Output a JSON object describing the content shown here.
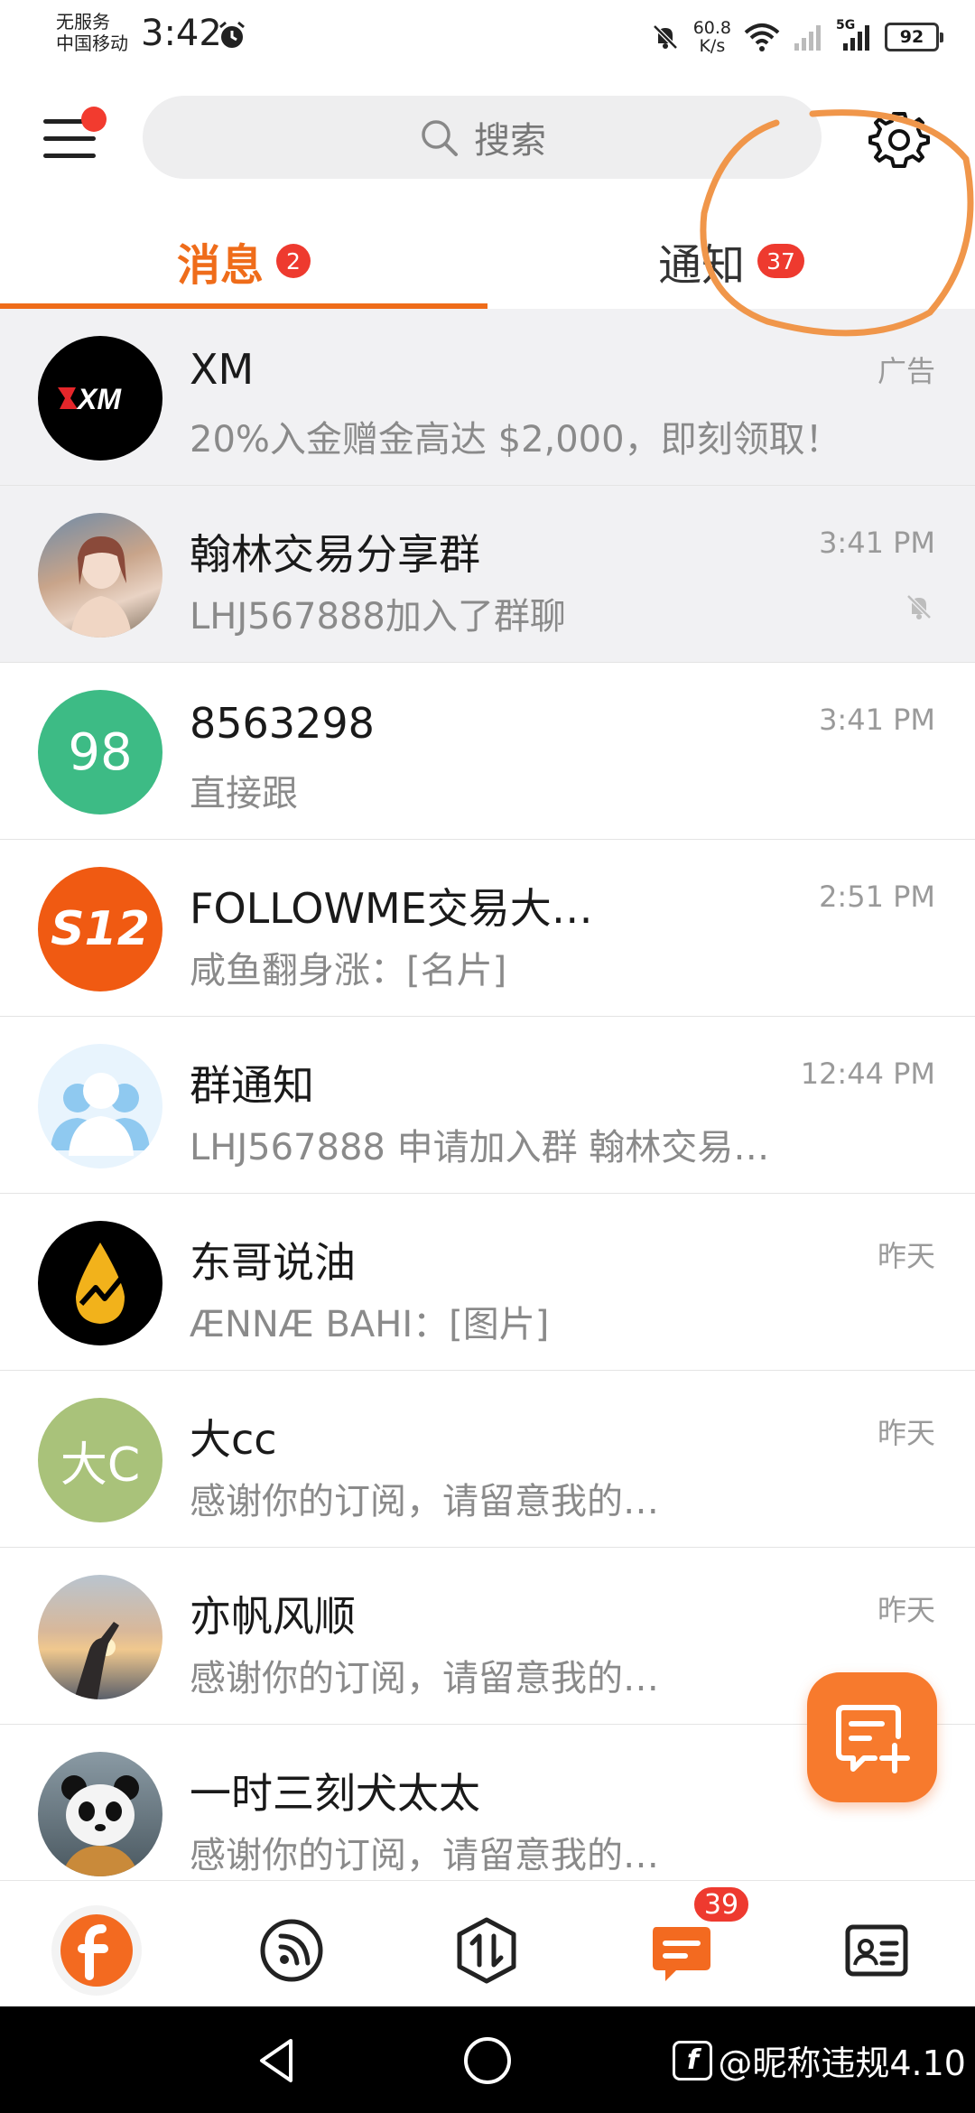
{
  "status_bar": {
    "carrier_line1": "无服务",
    "carrier_line2": "中国移动",
    "time": "3:42",
    "net_speed_value": "60.8",
    "net_speed_unit": "K/s",
    "signal_label": "5G",
    "battery": "92"
  },
  "header": {
    "search_placeholder": "搜索"
  },
  "tabs": [
    {
      "label": "消息",
      "badge": "2",
      "active": true
    },
    {
      "label": "通知",
      "badge": "37",
      "active": false
    }
  ],
  "chats": [
    {
      "name": "XM",
      "preview": "20%入金赠金高达 $2,000，即刻领取！",
      "time": "广告",
      "avatar_text": "XM",
      "avatar_color": "#000000",
      "pinned": true,
      "muted": false
    },
    {
      "name": "翰林交易分享群",
      "preview": "LHJ567888加入了群聊",
      "time": "3:41 PM",
      "avatar_text": "",
      "avatar_color": "#c8a48a",
      "pinned": true,
      "muted": true
    },
    {
      "name": "8563298",
      "preview": "直接跟",
      "time": "3:41 PM",
      "avatar_text": "98",
      "avatar_color": "#3dbb85",
      "pinned": false,
      "muted": false
    },
    {
      "name": "FOLLOWME交易大…",
      "preview": "咸鱼翻身涨：[名片]",
      "time": "2:51 PM",
      "avatar_text": "S12",
      "avatar_color": "#f05a12",
      "pinned": false,
      "muted": false
    },
    {
      "name": "群通知",
      "preview": "LHJ567888 申请加入群 翰林交易…",
      "time": "12:44 PM",
      "avatar_text": "",
      "avatar_color": "#8fc9f0",
      "pinned": false,
      "muted": false
    },
    {
      "name": "东哥说油",
      "preview": "ÆNNÆ BAHI：[图片]",
      "time": "昨天",
      "avatar_text": "",
      "avatar_color": "#000000",
      "pinned": false,
      "muted": false
    },
    {
      "name": "大cc",
      "preview": "感谢你的订阅，请留意我的…",
      "time": "昨天",
      "avatar_text": "大C",
      "avatar_color": "#a9c27a",
      "pinned": false,
      "muted": false
    },
    {
      "name": "亦帆风顺",
      "preview": "感谢你的订阅，请留意我的…",
      "time": "昨天",
      "avatar_text": "",
      "avatar_color": "#c9a58a",
      "pinned": false,
      "muted": false
    },
    {
      "name": "一时三刻犬太太",
      "preview": "感谢你的订阅，请留意我的…",
      "time": "",
      "avatar_text": "",
      "avatar_color": "#5a6a72",
      "pinned": false,
      "muted": false
    }
  ],
  "bottom_nav": {
    "badge": "39",
    "items": [
      "followme-icon",
      "feed-icon",
      "trade-icon",
      "messages-icon",
      "profile-card-icon"
    ]
  },
  "system_nav": {
    "watermark": "@昵称违规4.10"
  },
  "colors": {
    "accent": "#ef6c1a",
    "badge": "#ee3a2f",
    "annotation": "#f0964a"
  }
}
